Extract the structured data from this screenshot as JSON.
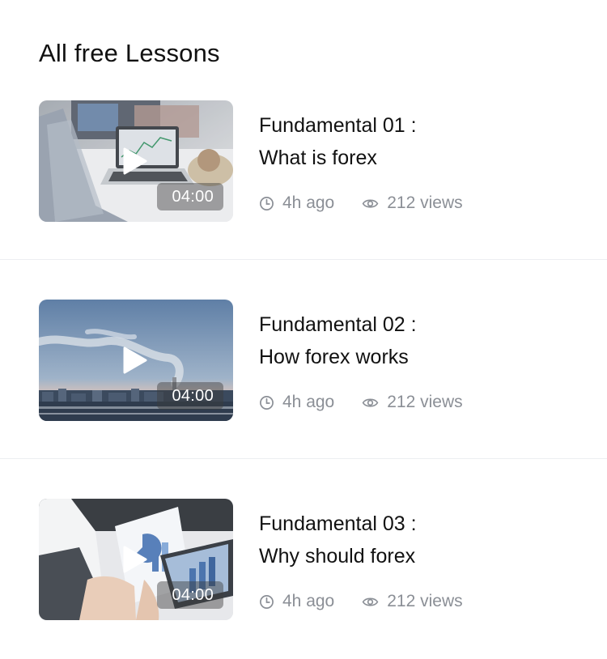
{
  "section": {
    "title": "All free Lessons"
  },
  "lessons": [
    {
      "title_line1": "Fundamental 01 :",
      "title_line2": "What is forex",
      "duration": "04:00",
      "time_ago": "4h ago",
      "views": "212 views",
      "thumbnail": "laptop-trading-chart"
    },
    {
      "title_line1": "Fundamental 02 :",
      "title_line2": "How forex works",
      "duration": "04:00",
      "time_ago": "4h ago",
      "views": "212 views",
      "thumbnail": "city-skyline-smoke"
    },
    {
      "title_line1": "Fundamental 03 :",
      "title_line2": "Why should forex",
      "duration": "04:00",
      "time_ago": "4h ago",
      "views": "212 views",
      "thumbnail": "business-charts-meeting"
    }
  ],
  "icons": {
    "play": "play-icon",
    "clock": "clock-icon",
    "views": "eye-icon"
  },
  "colors": {
    "title": "#111111",
    "meta": "#8b8f96",
    "divider": "#eceef1",
    "background": "#ffffff"
  }
}
